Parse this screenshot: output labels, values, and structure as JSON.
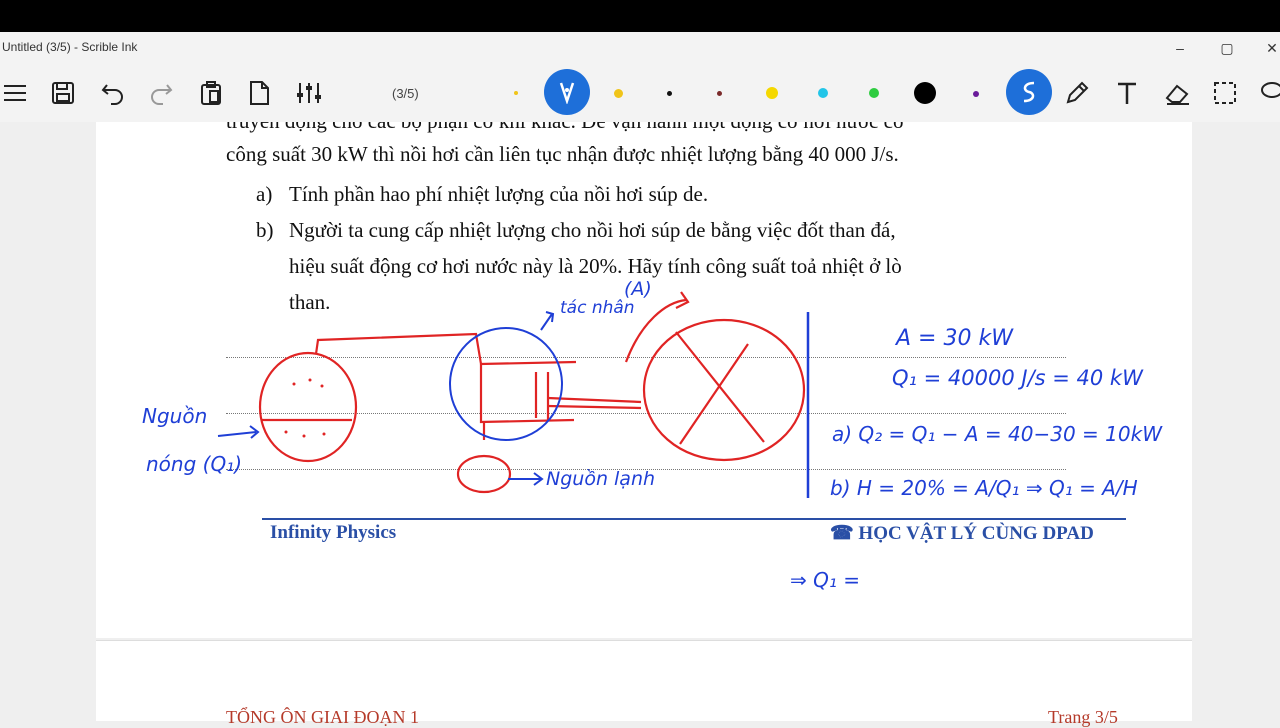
{
  "window": {
    "title": "Untitled (3/5) - Scrible Ink",
    "minimize": "–",
    "maximize": "▢",
    "close": "✕"
  },
  "toolbar": {
    "page_indicator": "(3/5)",
    "icons": [
      "menu-icon",
      "save-icon",
      "undo-icon",
      "redo-icon",
      "clipboard-icon",
      "page-icon",
      "sliders-icon",
      "pen-icon",
      "scribble-icon",
      "pencil-icon",
      "text-icon",
      "eraser-icon",
      "select-icon",
      "lasso-icon"
    ],
    "pen_colors": [
      "#f0c419",
      "#111111",
      "#7a2a2a",
      "#f5d800",
      "#22c5e8",
      "#2ecc40",
      "#000000",
      "#6a1b9a"
    ],
    "accent": "#1e6fd9"
  },
  "document": {
    "line_top": "truyền động cho các bộ phận cơ khí khác. Để vận hành một động cơ hơi nước có",
    "line_2": "công suất 30 kW thì nồi hơi cần liên tục nhận được nhiệt lượng bằng 40 000 J/s.",
    "item_a_label": "a)",
    "item_a_text": "Tính phần hao phí nhiệt lượng của nồi hơi súp de.",
    "item_b_label": "b)",
    "item_b_text_1": "Người ta cung cấp nhiệt lượng cho nồi hơi súp de bằng việc đốt than đá,",
    "item_b_text_2": "hiệu suất động cơ hơi nước này là 20%. Hãy tính công suất toả nhiệt ở lò",
    "item_b_text_3": "than.",
    "footer_left": "Infinity Physics",
    "footer_right": "☎ HỌC VẬT LÝ CÙNG DPAD",
    "next_page_left": "TỔNG ÔN GIAI ĐOẠN 1",
    "next_page_right": "Trang 3/5"
  },
  "handwriting": {
    "hot_source": "Nguồn",
    "hot_source_2": "nóng (Q₁)",
    "cold_source": "Nguồn lạnh",
    "work_label": "tác nhân",
    "work_A": "(A)",
    "eq1": "A = 30 kW",
    "eq2": "Q₁ = 40000 J/s = 40 kW",
    "eq3": "a)  Q₂ = Q₁ − A = 40−30 = 10kW",
    "eq4": "b)  H = 20% = A/Q₁ ⇒ Q₁ = A/H",
    "eq5": "⇒ Q₁ ="
  }
}
